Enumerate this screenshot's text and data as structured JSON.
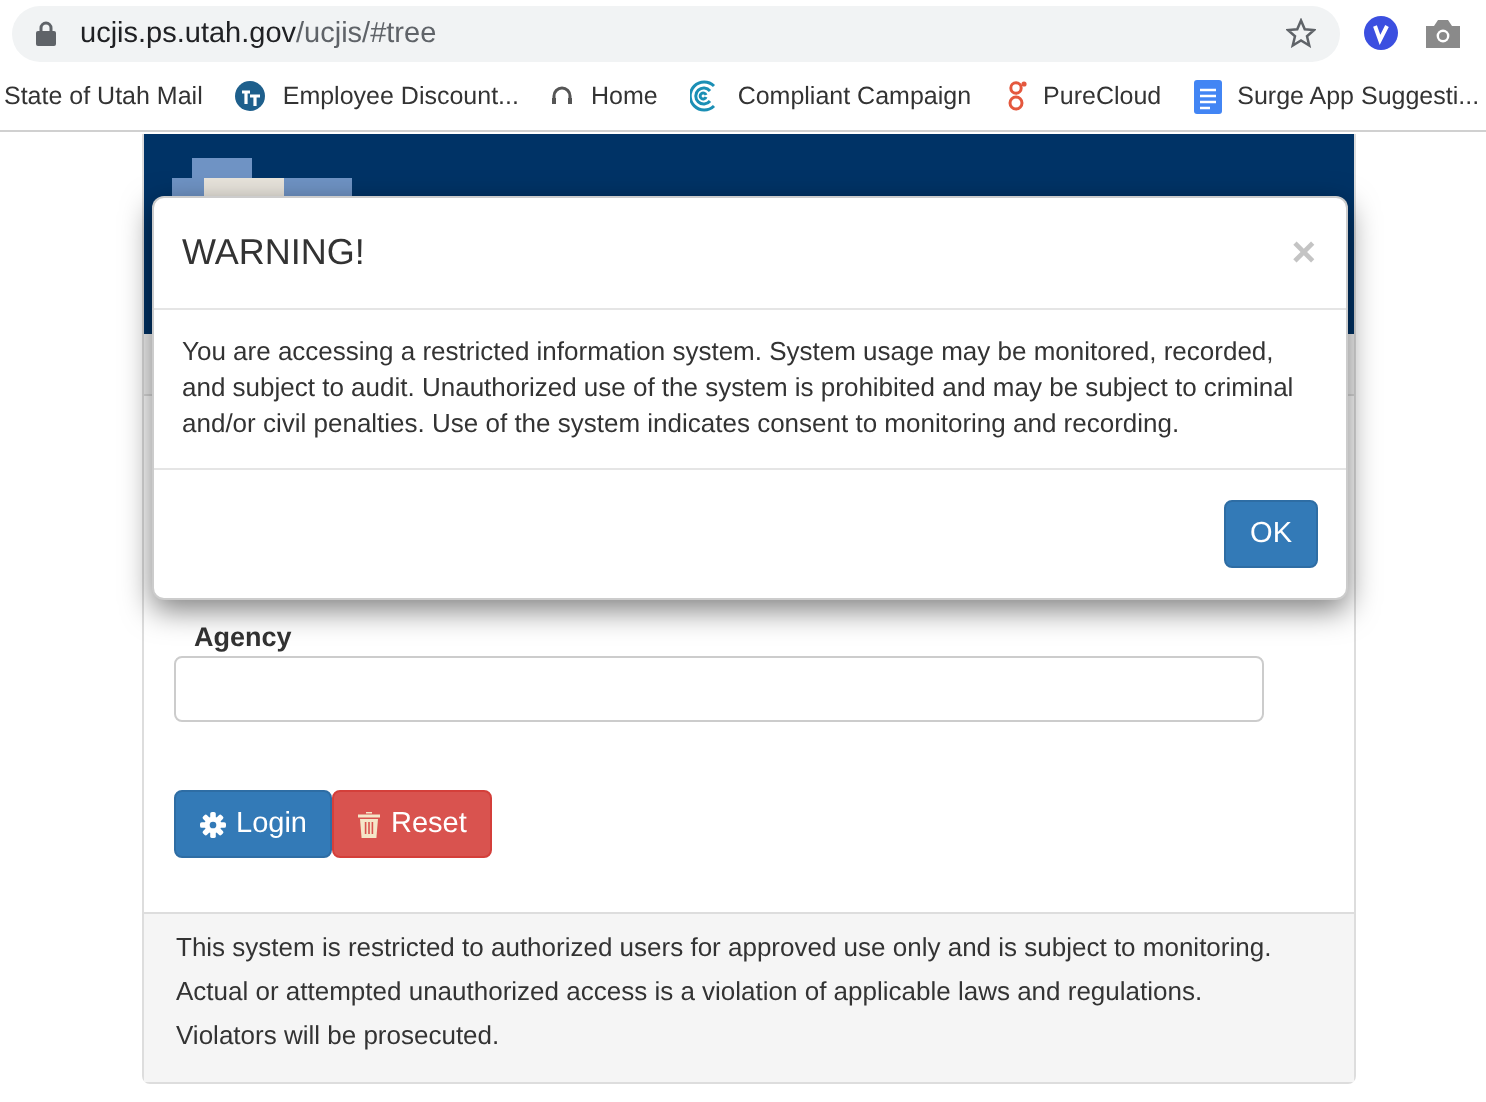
{
  "browser": {
    "url_host": "ucjis.ps.utah.gov",
    "url_path": "/ucjis/#tree",
    "bookmarks": [
      {
        "label": "State of Utah Mail",
        "kind": "none"
      },
      {
        "label": "Employee Discount...",
        "kind": "badge"
      },
      {
        "label": "Home",
        "kind": "headset"
      },
      {
        "label": "Compliant Campaign",
        "kind": "wave"
      },
      {
        "label": "PureCloud",
        "kind": "figure"
      },
      {
        "label": "Surge App Suggesti...",
        "kind": "doc"
      }
    ]
  },
  "form": {
    "fields": [
      {
        "label": "Agency"
      }
    ],
    "buttons": [
      {
        "label": "Login",
        "kind": "primary"
      },
      {
        "label": "Reset",
        "kind": "danger"
      }
    ]
  },
  "footer_notice": "This system is restricted to authorized users for approved use only and is subject to monitoring. Actual or attempted unauthorized access is a violation of applicable laws and regulations. Violators will be prosecuted.",
  "modal": {
    "title": "WARNING!",
    "close": "×",
    "body": "You are accessing a restricted information system. System usage may be monitored, recorded, and subject to audit. Unauthorized use of the system is prohibited and may be subject to criminal and/or civil penalties. Use of the system indicates consent to monitoring and recording.",
    "buttons": [
      "OK"
    ]
  }
}
